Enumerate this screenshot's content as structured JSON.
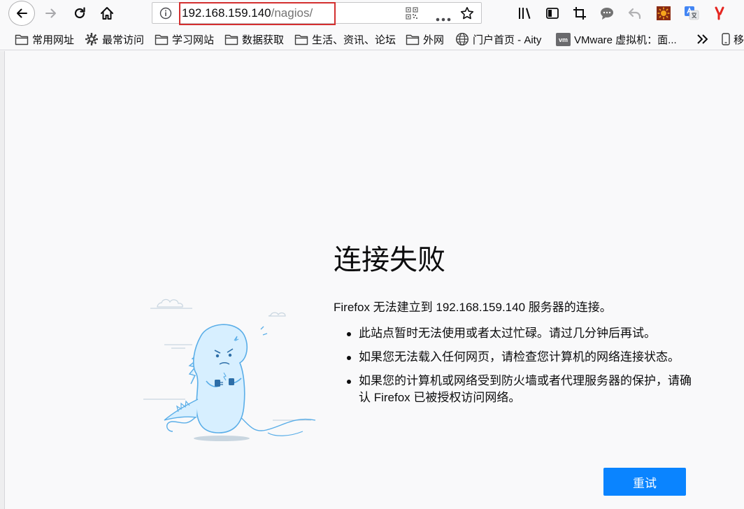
{
  "toolbar": {
    "url_host": "192.168.159.140",
    "url_path": "/nagios/"
  },
  "bookmarks": [
    {
      "label": "常用网址",
      "icon": "folder-icon"
    },
    {
      "label": "最常访问",
      "icon": "gear-icon"
    },
    {
      "label": "学习网站",
      "icon": "folder-icon"
    },
    {
      "label": "数据获取",
      "icon": "folder-icon"
    },
    {
      "label": "生活、资讯、论坛",
      "icon": "folder-icon"
    },
    {
      "label": "外网",
      "icon": "folder-icon"
    },
    {
      "label": "门户首页 - Aity",
      "icon": "globe-icon"
    },
    {
      "label": "VMware 虚拟机：面...",
      "icon": "vm-icon"
    },
    {
      "label": "移",
      "icon": "mobile-icon"
    }
  ],
  "error": {
    "title": "连接失败",
    "description": "Firefox 无法建立到 192.168.159.140 服务器的连接。",
    "bullets": [
      "此站点暂时无法使用或者太过忙碌。请过几分钟后再试。",
      "如果您无法载入任何网页，请检查您计算机的网络连接状态。",
      "如果您的计算机或网络受到防火墙或者代理服务器的保护，请确认 Firefox 已被授权访问网络。"
    ],
    "retry_label": "重试"
  },
  "colors": {
    "accent": "#0a84ff",
    "highlight_box": "#d32f2f"
  }
}
